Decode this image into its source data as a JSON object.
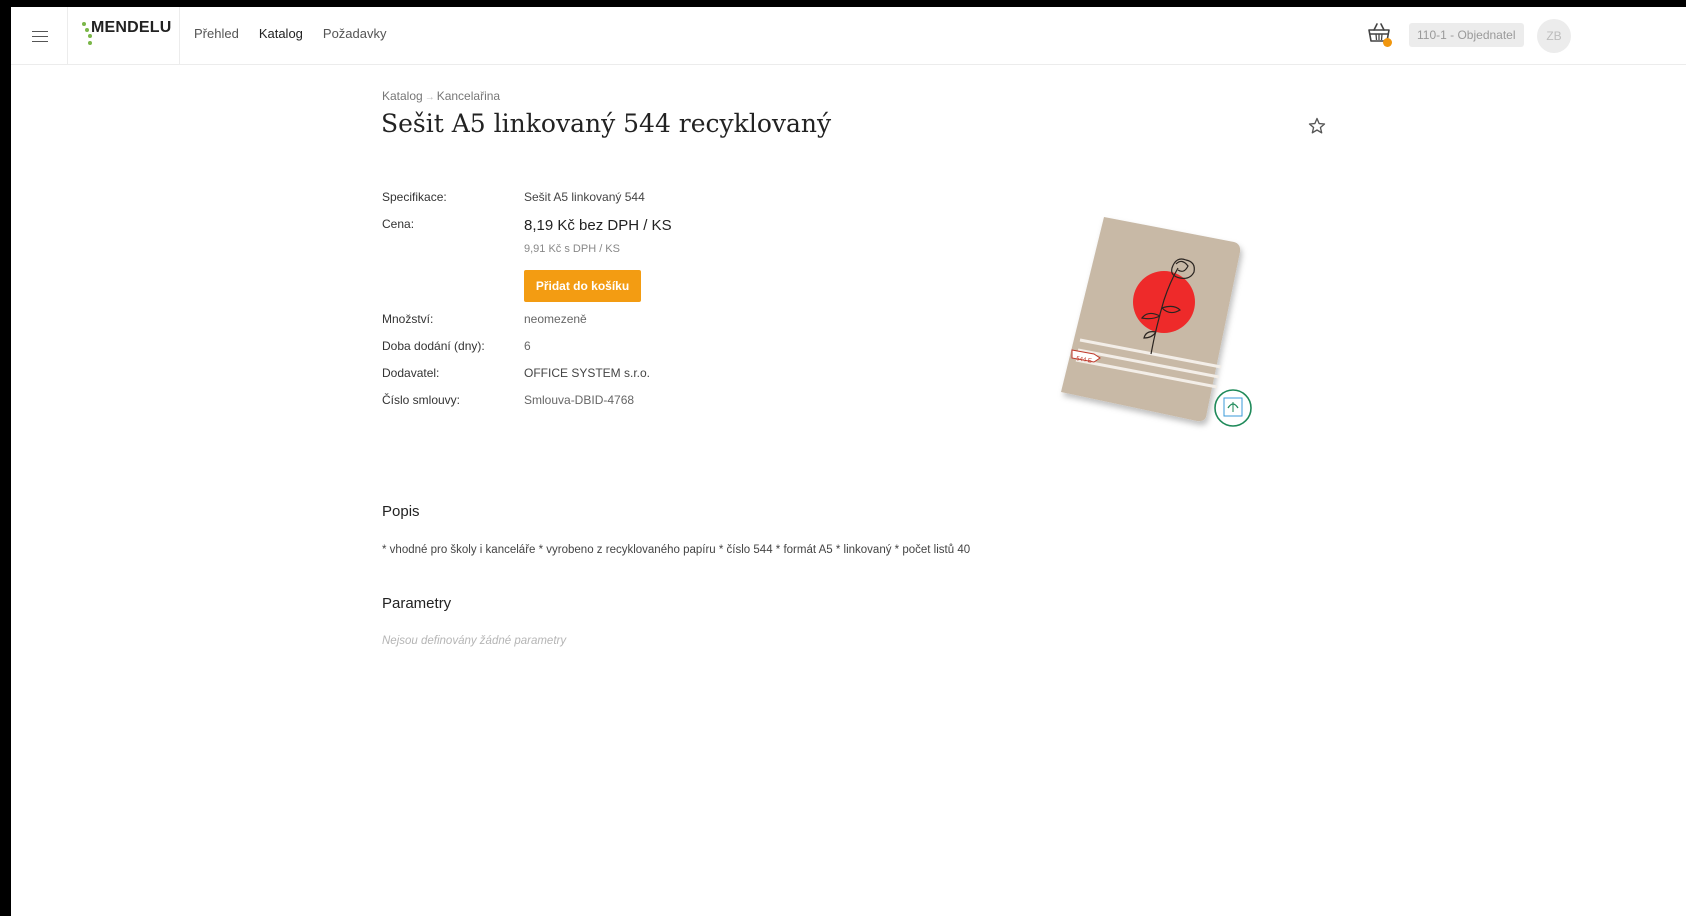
{
  "header": {
    "logo_text": "MENDELU",
    "nav": [
      {
        "label": "Přehled",
        "active": false
      },
      {
        "label": "Katalog",
        "active": true
      },
      {
        "label": "Požadavky",
        "active": false
      }
    ],
    "role": "110-1 - Objednatel",
    "avatar_initials": "ZB",
    "accent_color": "#f39c12"
  },
  "breadcrumb": {
    "root": "Katalog",
    "separator": "→",
    "current": "Kancelařina"
  },
  "product": {
    "title": "Sešit A5 linkovaný 544 recyklovaný",
    "specification_label": "Specifikace:",
    "specification": "Sešit A5 linkovaný 544",
    "price_label": "Cena:",
    "price_without_vat": "8,19 Kč bez DPH / KS",
    "price_with_vat": "9,91 Kč s DPH / KS",
    "add_to_cart_label": "Přidat do košíku",
    "quantity_label": "Množství:",
    "quantity": "neomezeně",
    "delivery_label": "Doba dodání (dny):",
    "delivery_days": "6",
    "supplier_label": "Dodavatel:",
    "supplier": "OFFICE SYSTEM s.r.o.",
    "contract_label": "Číslo smlouvy:",
    "contract": "Smlouva-DBID-4768",
    "cover_label": "544 E"
  },
  "description": {
    "heading": "Popis",
    "text": "* vhodné pro školy i kanceláře * vyrobeno z recyklovaného papíru * číslo 544 * formát A5 * linkovaný * počet listů 40"
  },
  "parameters": {
    "heading": "Parametry",
    "empty_text": "Nejsou definovány žádné parametry"
  }
}
